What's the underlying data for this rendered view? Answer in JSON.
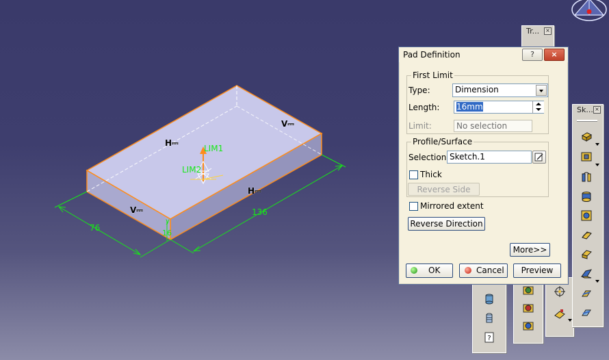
{
  "viewport": {
    "dimensions": {
      "width": "76",
      "length": "136",
      "height": "16"
    },
    "limit_labels": {
      "lim1": "LIM1",
      "lim2": "LIM2"
    },
    "constraint_marks": {
      "h": "H",
      "v": "V"
    },
    "axis_label": "y"
  },
  "toolbars": [
    {
      "title": "Tr...",
      "close": "×"
    },
    {
      "title": "Sk...",
      "close": "×"
    }
  ],
  "dialog": {
    "title": "Pad Definition",
    "help_button": "?",
    "close_button": "×",
    "first_limit": {
      "legend": "First Limit",
      "type_label": "Type:",
      "type_value": "Dimension",
      "length_label": "Length:",
      "length_value": "16mm",
      "limit_label": "Limit:",
      "limit_value": "No selection"
    },
    "profile_surface": {
      "legend": "Profile/Surface",
      "selection_label": "Selection:",
      "selection_value": "Sketch.1",
      "thick_label": "Thick",
      "thick_checked": false,
      "reverse_side": "Reverse Side"
    },
    "mirrored_extent_label": "Mirrored extent",
    "mirrored_extent_checked": false,
    "reverse_direction": "Reverse Direction",
    "more": "More>>",
    "ok": "OK",
    "cancel": "Cancel",
    "preview": "Preview"
  },
  "colors": {
    "accent_orange": "#ff8c1a",
    "dimension_green": "#17e817",
    "selection_blue": "#316ac5"
  }
}
